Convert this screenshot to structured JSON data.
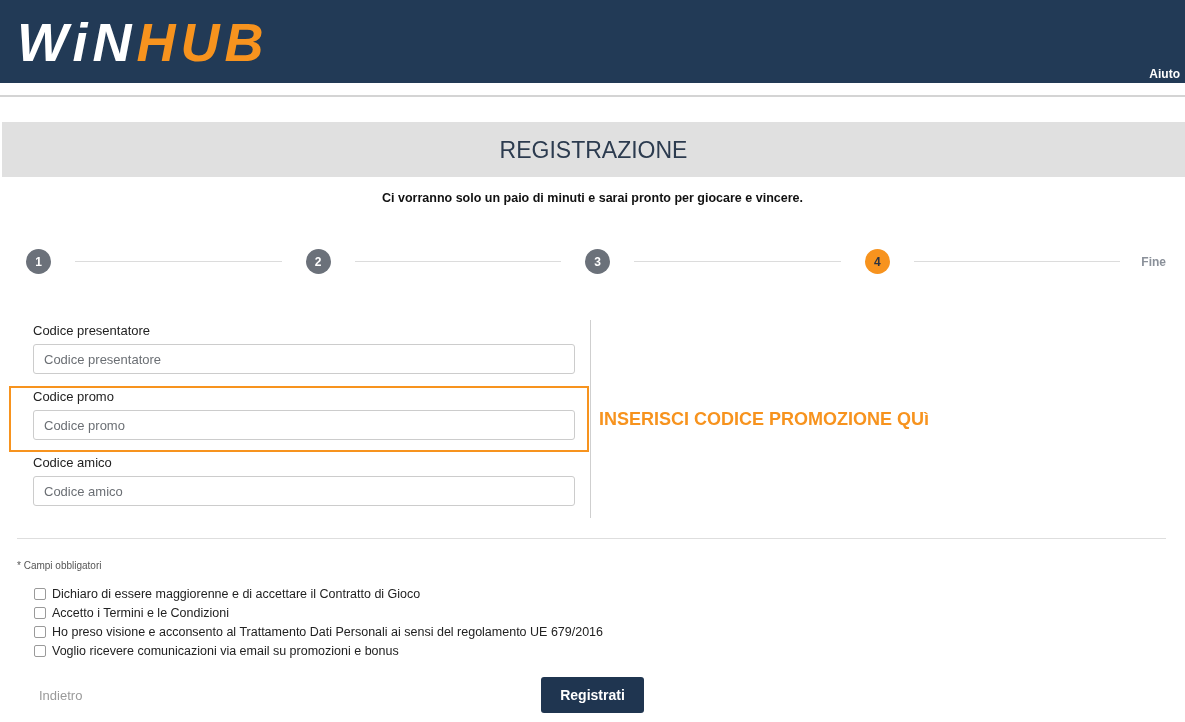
{
  "header": {
    "logo": [
      {
        "text": "WiN",
        "color": "#ffffff"
      },
      {
        "text": "HUB",
        "color": "#f7931e"
      }
    ],
    "help_link": "Aiuto"
  },
  "title": "REGISTRAZIONE",
  "subtitle": "Ci vorranno solo un paio di minuti e sarai pronto per giocare e vincere.",
  "steps": [
    {
      "kind": "number",
      "label": "1",
      "selected": false
    },
    {
      "kind": "number",
      "label": "2",
      "selected": false
    },
    {
      "kind": "number",
      "label": "3",
      "selected": false
    },
    {
      "kind": "number",
      "label": "4",
      "selected": true
    },
    {
      "kind": "end",
      "label": "Fine",
      "selected": false
    }
  ],
  "form": {
    "fields": [
      {
        "label": "Codice presentatore",
        "placeholder": "Codice presentatore",
        "highlighted": false
      },
      {
        "label": "Codice promo",
        "placeholder": "Codice promo",
        "highlighted": true,
        "annotation": "INSERISCI CODICE PROMOZIONE QUì"
      },
      {
        "label": "Codice amico",
        "placeholder": "Codice amico",
        "highlighted": false
      }
    ]
  },
  "required_note": "* Campi obbligatori",
  "consents": [
    {
      "label": "Dichiaro di essere maggiorenne e di accettare il Contratto di Gioco",
      "checked": false
    },
    {
      "label": "Accetto i Termini e le Condizioni",
      "checked": false
    },
    {
      "label": "Ho preso visione e acconsento al Trattamento Dati Personali ai sensi del regolamento UE 679/2016",
      "checked": false
    },
    {
      "label": "Voglio ricevere comunicazioni via email su promozioni e bonus",
      "checked": false
    }
  ],
  "actions": {
    "back_link": "Indietro",
    "submit_button": "Registrati"
  }
}
